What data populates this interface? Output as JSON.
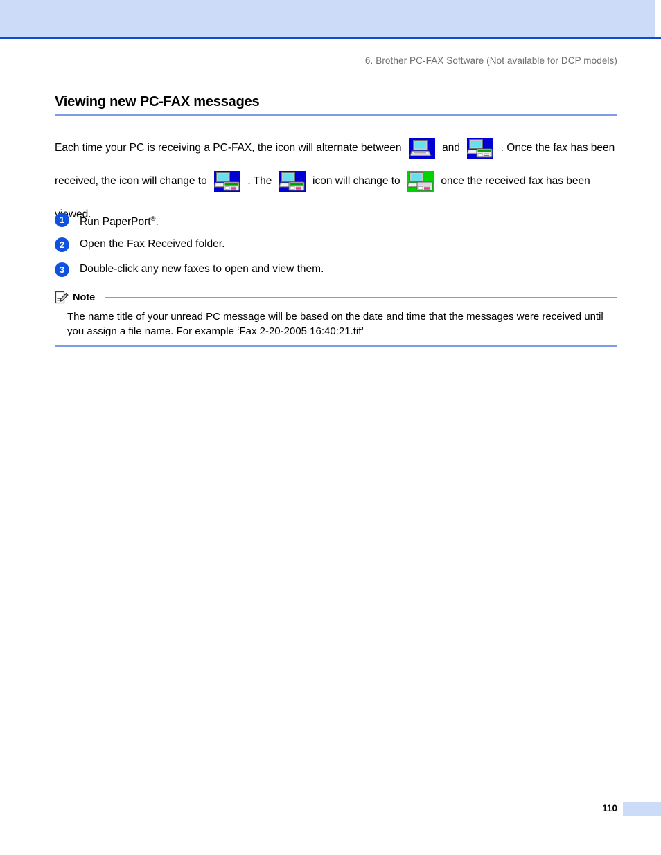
{
  "header": {
    "running_header": "6. Brother PC-FAX Software (Not available for DCP models)"
  },
  "section": {
    "heading": "Viewing new PC-FAX messages"
  },
  "paragraph": {
    "part1": "Each time your PC is receiving a PC-FAX, the icon will alternate between",
    "part2": "and",
    "part3": ". Once the fax has been received, the icon will change to",
    "part4": ". The",
    "part5": "icon will change to",
    "part6": "once the received fax has been viewed."
  },
  "icons": {
    "computer_blue": "computer-blue-icon",
    "computer_fax_blue": "computer-fax-blue-icon",
    "computer_fax_blue_2": "computer-fax-blue-icon",
    "computer_fax_blue_3": "computer-fax-blue-icon",
    "computer_fax_green": "computer-fax-green-icon",
    "note_pencil": "note-pencil-icon"
  },
  "steps": [
    {
      "number": "1",
      "text": "Run PaperPort",
      "sup": "®",
      "suffix": "."
    },
    {
      "number": "2",
      "text": "Open the Fax Received folder.",
      "sup": "",
      "suffix": ""
    },
    {
      "number": "3",
      "text": "Double-click any new faxes to open and view them.",
      "sup": "",
      "suffix": ""
    }
  ],
  "note": {
    "label": "Note",
    "body": "The name title of your unread PC message will be based on the date and time that the messages were received until you assign a file name. For example ‘Fax 2-20-2005 16:40:21.tif’"
  },
  "footer": {
    "page_number": "110"
  },
  "colors": {
    "band_blue": "#ccdcf8",
    "rule_blue": "#0b4fd0",
    "accent_blue": "#7d9ce8",
    "badge_blue": "#0f52e0",
    "icon_bg_blue": "#0000d4",
    "icon_bg_green": "#00d400",
    "screen_cyan": "#66e0ee",
    "header_gray": "#6e6e6e"
  }
}
